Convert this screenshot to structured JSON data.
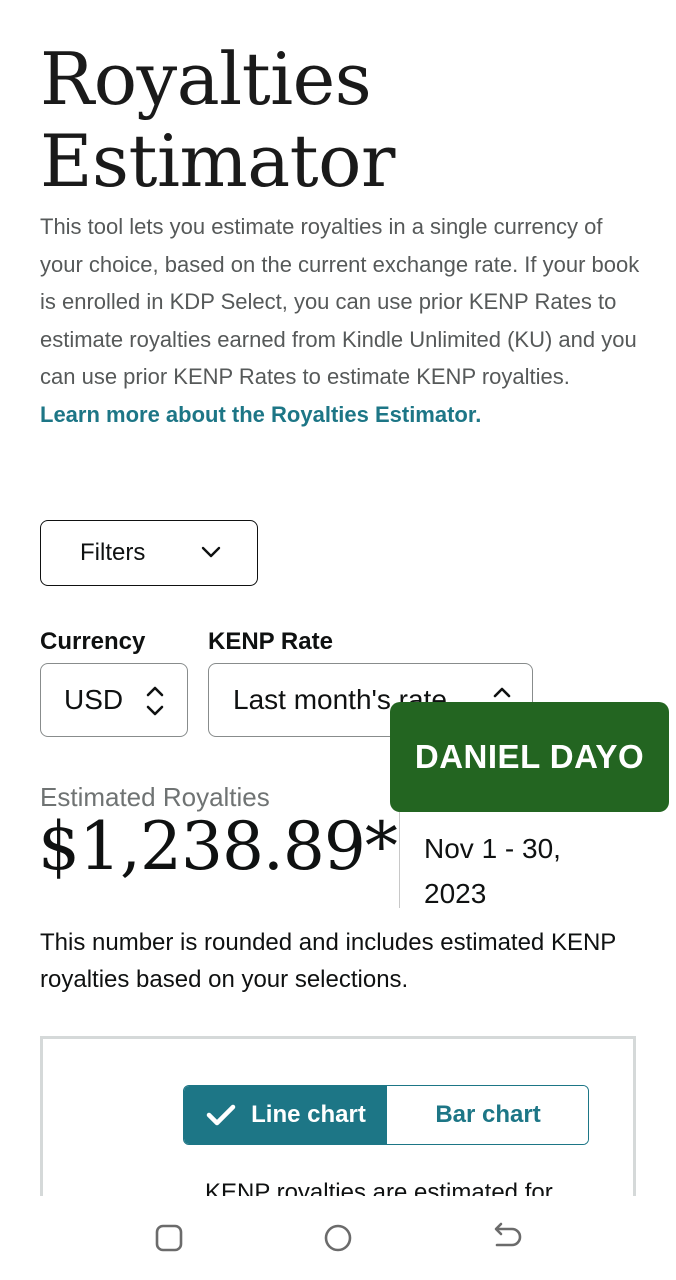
{
  "page": {
    "title_line1": "Royalties",
    "title_line2": "Estimator",
    "description": "This tool lets you estimate royalties in a single currency of your choice, based on the current exchange rate. If your book is enrolled in KDP Select, you can use prior KENP Rates to estimate royalties earned from Kindle Unlimited (KU) and you can use prior KENP Rates to estimate KENP royalties.",
    "learn_more_link": "Learn more about the Royalties Estimator."
  },
  "filters": {
    "button_label": "Filters",
    "icon": "chevron-down-icon"
  },
  "currency": {
    "label": "Currency",
    "value": "USD",
    "icon": "up-down-chevron-icon"
  },
  "kenp_rate": {
    "label": "KENP Rate",
    "value": "Last month's rate",
    "icon": "chevron-up-icon"
  },
  "watermark": {
    "text": "DANIEL DAYO",
    "background": "#236521"
  },
  "estimate": {
    "label": "Estimated Royalties",
    "amount": "$1,238.89*",
    "period": "Nov 1 - 30, 2023",
    "note": "This number is rounded and includes estimated KENP royalties based on your selections."
  },
  "chart_toggle": {
    "options": [
      {
        "label": "Line chart",
        "selected": true,
        "icon": "checkmark-icon"
      },
      {
        "label": "Bar chart",
        "selected": false
      }
    ],
    "accent": "#1d7686"
  },
  "chart_note": "KENP royalties are estimated for",
  "navbar": {
    "recent_icon": "recent-apps-icon",
    "home_icon": "home-icon",
    "back_icon": "back-icon"
  }
}
